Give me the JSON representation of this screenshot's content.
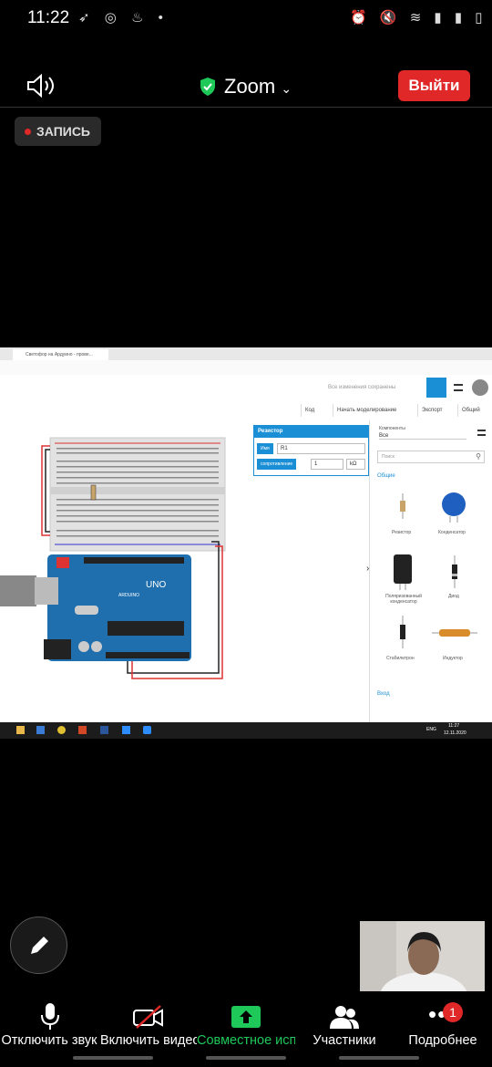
{
  "status_bar": {
    "time": "11:22"
  },
  "header": {
    "app_title": "Zoom",
    "leave_label": "Выйти",
    "recording_label": "ЗАПИСЬ"
  },
  "shared_screen": {
    "saved_text": "Все изменения сохранены",
    "toolbar": {
      "code_label": "Код",
      "simulate_label": "Начать моделирование",
      "export_label": "Экспорт",
      "share_label": "Общий"
    },
    "props": {
      "title": "Резистор",
      "name_label": "Имя",
      "name_value": "R1",
      "resistance_label": "сопротивление",
      "resistance_value": "1",
      "unit": "kΩ"
    },
    "panel": {
      "components_label": "Компоненты",
      "components_value": "Все",
      "search_placeholder": "Поиск",
      "section_basic": "Общие",
      "section_input": "Вход",
      "items": [
        "Резистор",
        "Конденсатор",
        "Поляризованный конденсатор",
        "Диод",
        "Стабилитрон",
        "Индуктор"
      ]
    },
    "taskbar": {
      "lang": "ENG",
      "time": "11:27",
      "date": "12.11.2020"
    }
  },
  "bottom_bar": {
    "mute_label": "Отключить звук",
    "video_label": "Включить видео",
    "share_label": "Совместное использование",
    "participants_label": "Участники",
    "more_label": "Подробнее",
    "more_badge": "1"
  },
  "colors": {
    "leave": "#e02828",
    "share_green": "#1ec95a",
    "tinkercad_blue": "#1b8fd6",
    "arduino_blue": "#1f6fae"
  }
}
